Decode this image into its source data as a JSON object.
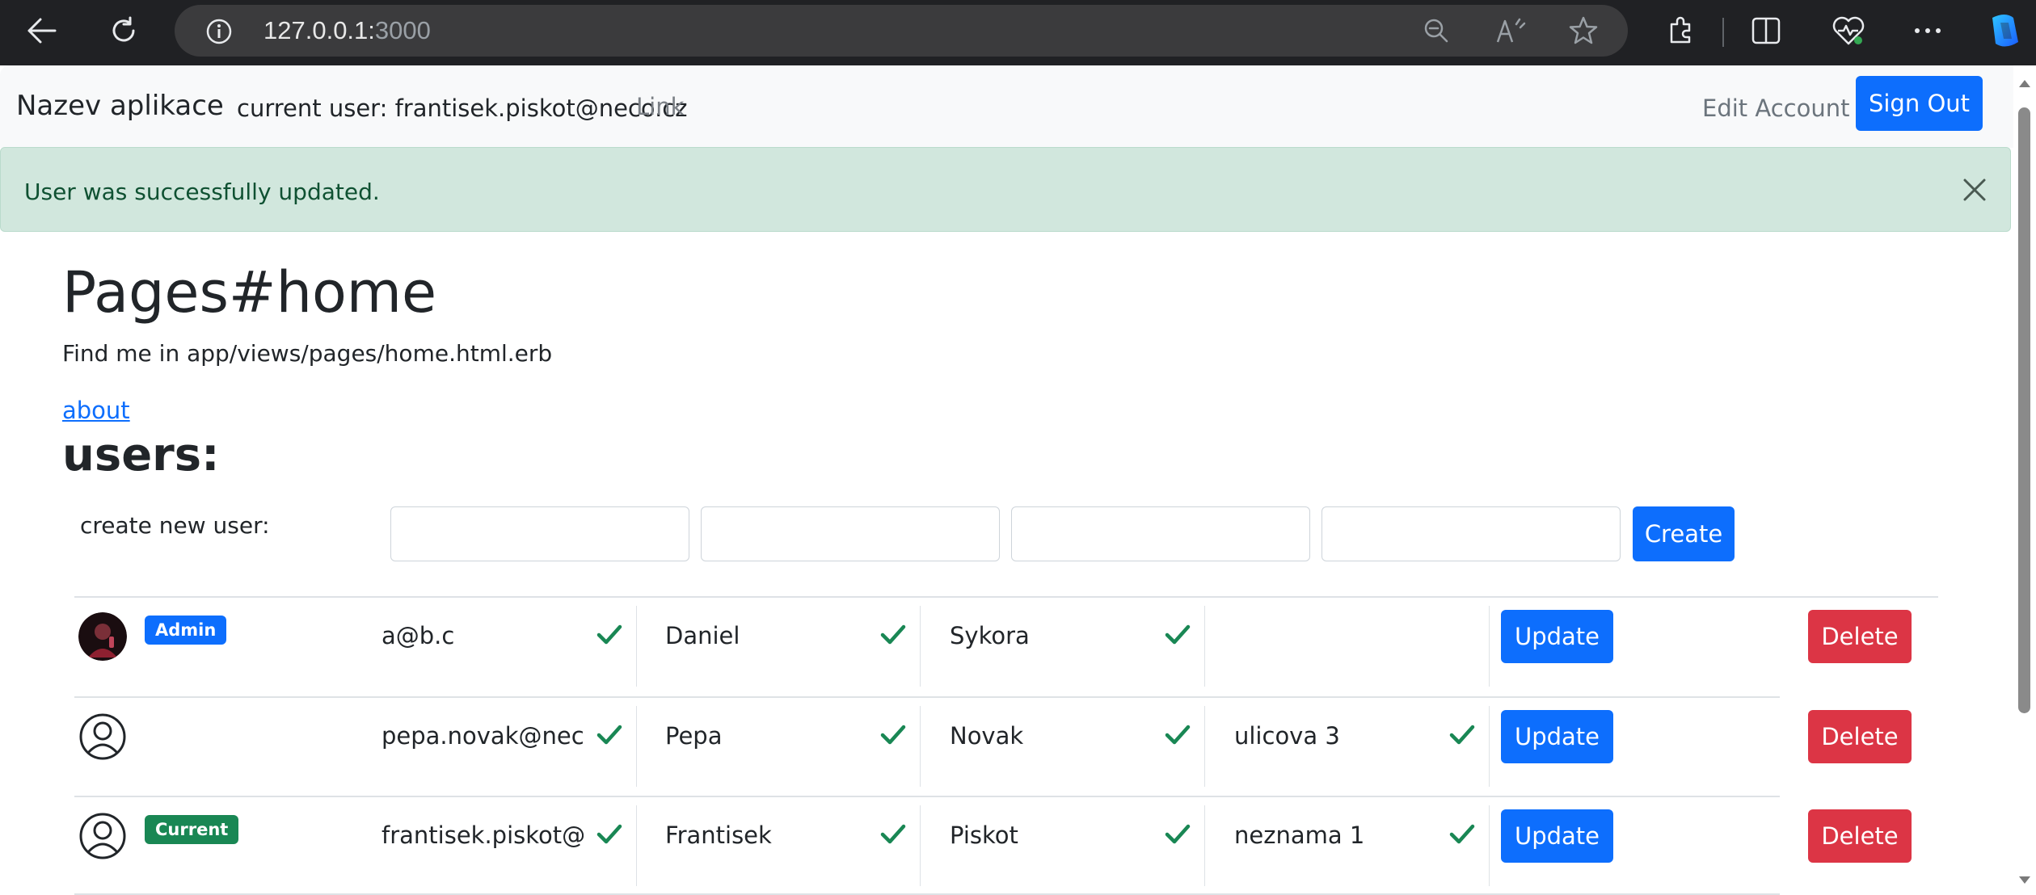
{
  "browser": {
    "url_host": "127.0.0.1:",
    "url_port": "3000"
  },
  "navbar": {
    "brand": "Nazev aplikace",
    "current_user": "current user: frantisek.piskot@neco.cz",
    "link": "Link",
    "edit_account": "Edit Account",
    "sign_out": "Sign Out"
  },
  "alert": {
    "message": "User was successfully updated."
  },
  "content": {
    "title": "Pages#home",
    "subtitle": "Find me in app/views/pages/home.html.erb",
    "about_link": "about",
    "users_heading": "users:"
  },
  "create_form": {
    "label": "create new user:",
    "inputs": [
      "",
      "",
      "",
      ""
    ],
    "button": "Create"
  },
  "users": [
    {
      "avatar": "photo",
      "badge": "Admin",
      "badge_color": "#0d6efd",
      "email": "a@b.c",
      "first_name": "Daniel",
      "last_name": "Sykora",
      "address": "",
      "update": "Update",
      "delete": "Delete"
    },
    {
      "avatar": "user-icon",
      "badge": "",
      "badge_color": "",
      "email": "pepa.novak@neco.c",
      "first_name": "Pepa",
      "last_name": "Novak",
      "address": "ulicova 3",
      "update": "Update",
      "delete": "Delete"
    },
    {
      "avatar": "user-icon",
      "badge": "Current",
      "badge_color": "#198754",
      "email": "frantisek.piskot@ne",
      "first_name": "Frantisek",
      "last_name": "Piskot",
      "address": "neznama 1",
      "update": "Update",
      "delete": "Delete"
    }
  ],
  "colors": {
    "primary": "#0d6efd",
    "danger": "#dc3545",
    "success": "#198754",
    "alert_bg": "#d1e7dd"
  }
}
